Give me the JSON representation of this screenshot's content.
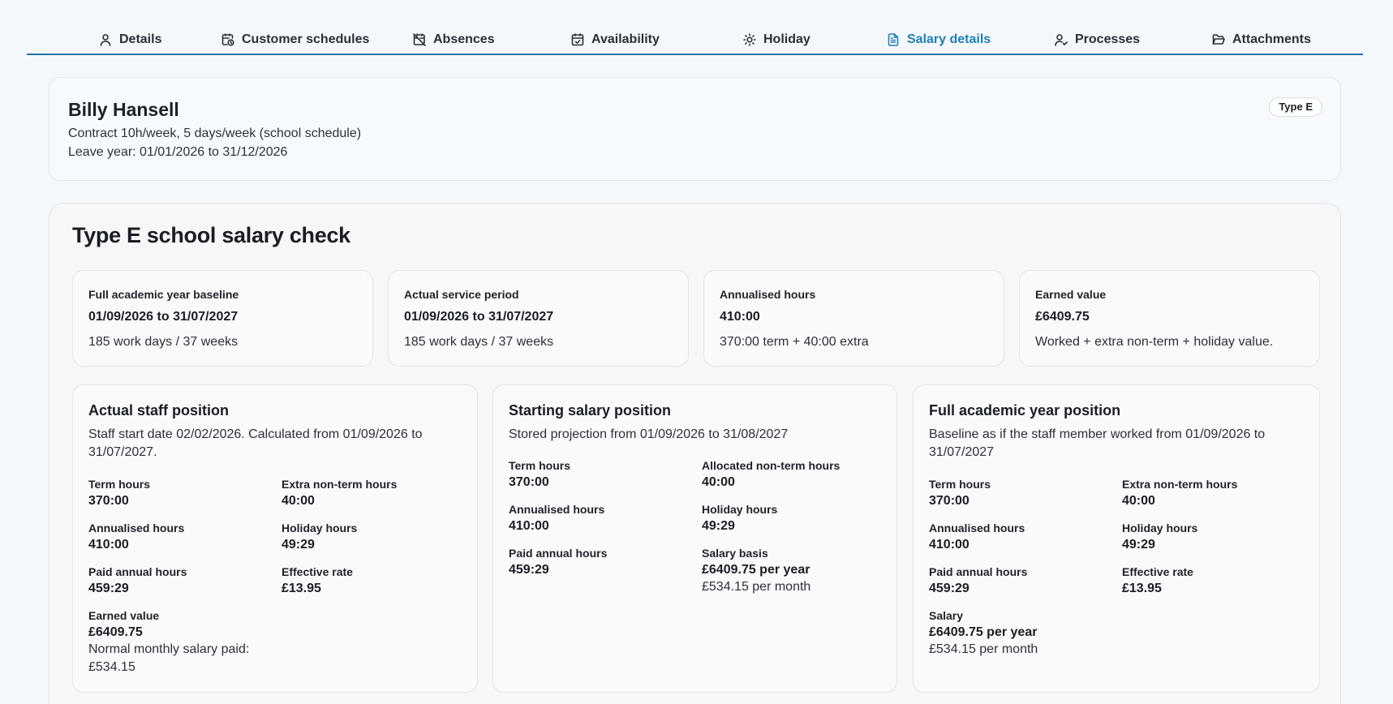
{
  "tabs": [
    {
      "label": "Details",
      "icon": "user-icon"
    },
    {
      "label": "Customer schedules",
      "icon": "calendar-clock-icon"
    },
    {
      "label": "Absences",
      "icon": "calendar-off-icon"
    },
    {
      "label": "Availability",
      "icon": "calendar-check-icon"
    },
    {
      "label": "Holiday",
      "icon": "sun-icon"
    },
    {
      "label": "Salary details",
      "icon": "file-text-icon",
      "active": true
    },
    {
      "label": "Processes",
      "icon": "user-check-icon"
    },
    {
      "label": "Attachments",
      "icon": "folder-open-icon"
    }
  ],
  "employee": {
    "name": "Billy Hansell",
    "contract": "Contract 10h/week, 5 days/week (school schedule)",
    "leave_year": "Leave year: 01/01/2026 to 31/12/2026",
    "type_badge": "Type E"
  },
  "salary_check": {
    "title": "Type E school salary check",
    "stats": [
      {
        "label": "Full academic year baseline",
        "value": "01/09/2026 to 31/07/2027",
        "sub": "185 work days / 37 weeks"
      },
      {
        "label": "Actual service period",
        "value": "01/09/2026 to 31/07/2027",
        "sub": "185 work days / 37 weeks"
      },
      {
        "label": "Annualised hours",
        "value": "410:00",
        "sub": "370:00 term + 40:00 extra"
      },
      {
        "label": "Earned value",
        "value": "£6409.75",
        "sub": "Worked + extra non-term + holiday value."
      }
    ],
    "actual": {
      "title": "Actual staff position",
      "desc": "Staff start date 02/02/2026. Calculated from 01/09/2026 to 31/07/2027.",
      "term_hours_label": "Term hours",
      "term_hours": "370:00",
      "extra_label": "Extra non-term hours",
      "extra": "40:00",
      "annualised_label": "Annualised hours",
      "annualised": "410:00",
      "holiday_label": "Holiday hours",
      "holiday": "49:29",
      "paid_label": "Paid annual hours",
      "paid": "459:29",
      "rate_label": "Effective rate",
      "rate": "£13.95",
      "earned_label": "Earned value",
      "earned": "£6409.75",
      "monthly_note": "Normal monthly salary paid: £534.15"
    },
    "starting": {
      "title": "Starting salary position",
      "desc": "Stored projection from 01/09/2026 to 31/08/2027",
      "term_hours_label": "Term hours",
      "term_hours": "370:00",
      "allocated_label": "Allocated non-term hours",
      "allocated": "40:00",
      "annualised_label": "Annualised hours",
      "annualised": "410:00",
      "holiday_label": "Holiday hours",
      "holiday": "49:29",
      "paid_label": "Paid annual hours",
      "paid": "459:29",
      "basis_label": "Salary basis",
      "basis_year": "£6409.75 per year",
      "basis_month": "£534.15 per month"
    },
    "full_year": {
      "title": "Full academic year position",
      "desc": "Baseline as if the staff member worked from 01/09/2026 to 31/07/2027",
      "term_hours_label": "Term hours",
      "term_hours": "370:00",
      "extra_label": "Extra non-term hours",
      "extra": "40:00",
      "annualised_label": "Annualised hours",
      "annualised": "410:00",
      "holiday_label": "Holiday hours",
      "holiday": "49:29",
      "paid_label": "Paid annual hours",
      "paid": "459:29",
      "rate_label": "Effective rate",
      "rate": "£13.95",
      "salary_label": "Salary",
      "salary_year": "£6409.75 per year",
      "salary_month": "£534.15 per month"
    }
  }
}
